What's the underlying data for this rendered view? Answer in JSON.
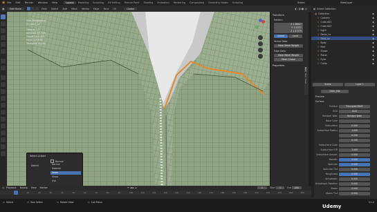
{
  "topbar": {
    "menus": [
      "File",
      "Edit",
      "Render",
      "Window",
      "Help"
    ],
    "workspaces": [
      "Layout",
      "Modeling",
      "Sculpting",
      "UV Editing",
      "Texture Paint",
      "Shading",
      "Animation",
      "Rendering",
      "Compositing",
      "Geometry Nodes",
      "Scripting"
    ],
    "active_workspace": "Layout",
    "scene_label": "Scene",
    "layer_label": "ViewLayer"
  },
  "header2": {
    "mode": "Edit Mode",
    "items": [
      "View",
      "Select",
      "Add",
      "Mesh",
      "Vertex",
      "Edge",
      "Face",
      "UV"
    ],
    "orientation": "Global"
  },
  "viewport_overlay": {
    "line1": "User Perspective",
    "line2": "(1) Shirt_Lo",
    "objects": "Objects 1/1",
    "vertices": "Vertices 2/7,738",
    "edges": "Edges 1/15,409",
    "faces": "Faces 0/7,676",
    "triangles": "Triangles 15,162"
  },
  "npanel": {
    "section_transform": "Transform",
    "median_label": "Median:",
    "x": "X  1.38847",
    "y": "Y  -0.0537",
    "z": "Z  1.31179",
    "global_btn": "Global",
    "local_btn": "Local",
    "vertex_data_label": "Vertex Data:",
    "vertex_weight": "Mean Bevel Weight",
    "edge_data_label": "Edge Data:",
    "edge_weight": "Mean Bevel Weight",
    "edge_crease": "Mean Crease",
    "properties_section": "Properties",
    "side_tabs": [
      "Item",
      "Tool",
      "View"
    ]
  },
  "outliner": {
    "title": "Scene Collection",
    "items": [
      {
        "label": "Collection",
        "selected": false
      },
      {
        "label": "Camera",
        "selected": false
      },
      {
        "label": "Cube.001",
        "selected": false
      },
      {
        "label": "Cube.002",
        "selected": false
      },
      {
        "label": "Light",
        "selected": false
      },
      {
        "label": "Pants_Lo",
        "selected": false
      },
      {
        "label": "Shirt_Lo",
        "selected": true
      },
      {
        "label": "Body",
        "selected": false
      },
      {
        "label": "Hair",
        "selected": false
      },
      {
        "label": "Shoes",
        "selected": false
      },
      {
        "label": "Plane",
        "selected": false
      },
      {
        "label": "Eyes",
        "selected": false
      },
      {
        "label": "Collar",
        "selected": false
      }
    ]
  },
  "properties": {
    "tabs": [
      "Scene",
      "Layer 1"
    ],
    "material_name": "Cloth_Mat",
    "preview_label": "Preview",
    "surface_label": "Surface",
    "surface_value": "Principled BSDF",
    "fields": [
      {
        "label": "GGX",
        "value": "GGX",
        "blue": false
      },
      {
        "label": "Random Walk",
        "value": "Random Walk",
        "blue": false
      },
      {
        "label": "Base Color",
        "value": "",
        "blue": false
      },
      {
        "label": "Subsurface",
        "value": "0.000",
        "blue": false
      },
      {
        "label": "Subsurface Radius",
        "value": "1.000",
        "blue": false
      },
      {
        "label": "",
        "value": "0.200",
        "blue": false
      },
      {
        "label": "",
        "value": "0.100",
        "blue": false
      },
      {
        "label": "Subsurface Color",
        "value": "",
        "blue": false
      },
      {
        "label": "Subsurface IOR",
        "value": "1.400",
        "blue": false
      },
      {
        "label": "Subsurface Anisotr.",
        "value": "0.000",
        "blue": false
      },
      {
        "label": "Metallic",
        "value": "0.000",
        "blue": true
      },
      {
        "label": "Specular",
        "value": "0.500",
        "blue": true
      },
      {
        "label": "Specular Tint",
        "value": "0.000",
        "blue": false
      },
      {
        "label": "Roughness",
        "value": "0.500",
        "blue": true
      },
      {
        "label": "Anisotropic",
        "value": "0.000",
        "blue": false
      },
      {
        "label": "Anisotropic Rotation",
        "value": "0.000",
        "blue": false
      },
      {
        "label": "Sheen",
        "value": "0.000",
        "blue": false
      },
      {
        "label": "Sheen Tint",
        "value": "0.500",
        "blue": false
      }
    ]
  },
  "popup": {
    "title": "Select Linked",
    "delimit_label": "Delimit",
    "checkbox_label": "Normal",
    "options": [
      "Normal",
      "Material",
      "Seam",
      "Sharp",
      "UVs"
    ],
    "active_option": "Seam"
  },
  "timeline": {
    "menus": [
      "Playback",
      "Keying",
      "View",
      "Marker"
    ],
    "frame": "1",
    "start_label": "Start",
    "start": "1",
    "end_label": "End",
    "end": "250",
    "ticks": [
      "0",
      "10",
      "20",
      "30",
      "40",
      "50",
      "60",
      "70",
      "80",
      "90",
      "100",
      "110",
      "120",
      "130",
      "140",
      "150",
      "160",
      "170",
      "180",
      "190",
      "200",
      "210",
      "220",
      "230",
      "240",
      "250"
    ]
  },
  "status": {
    "select": "Select",
    "box_select": "Box Select",
    "rotate_view": "Rotate View",
    "call_menu": "Call Menu",
    "version": "3.1.2",
    "watermark": "Udemy"
  },
  "colors": {
    "cloth": "#8fa383",
    "seam": "#e08a2a",
    "select": "#4772b3",
    "bg": "#2b2b2b"
  }
}
